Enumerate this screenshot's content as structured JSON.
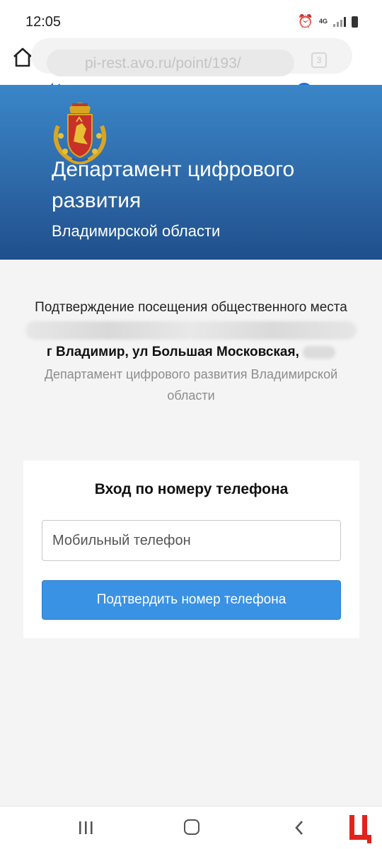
{
  "status_bar": {
    "time": "12:05",
    "network": "4G",
    "icons": [
      "alarm-icon",
      "4g-icon",
      "signal-icon",
      "battery-icon"
    ]
  },
  "browser": {
    "url": "pi-rest.avo.ru/point/193/",
    "tab_count": "3",
    "volume_level": 0.95,
    "icons": [
      "home-icon",
      "volume-icon",
      "chevron-down-icon",
      "more-vert-icon"
    ]
  },
  "header": {
    "title": "Департамент цифрового развития",
    "subtitle": "Владимирской области",
    "emblem": "vladimir-region-coat-of-arms"
  },
  "info": {
    "title": "Подтверждение посещения общественного места",
    "address": "г Владимир, ул Большая Московская,",
    "organization": "Департамент цифрового развития Владимирской области"
  },
  "login": {
    "title": "Вход по номеру телефона",
    "phone_placeholder": "Мобильный телефон",
    "phone_value": "",
    "submit_label": "Подтвердить номер телефона"
  },
  "nav": {
    "icons": [
      "recents-icon",
      "home-nav-icon",
      "back-icon"
    ]
  },
  "colors": {
    "header_top": "#3a86c8",
    "header_bottom": "#1f4f8c",
    "button": "#3a92e4",
    "accent": "#1f6fd8",
    "watermark": "#e2231a"
  }
}
